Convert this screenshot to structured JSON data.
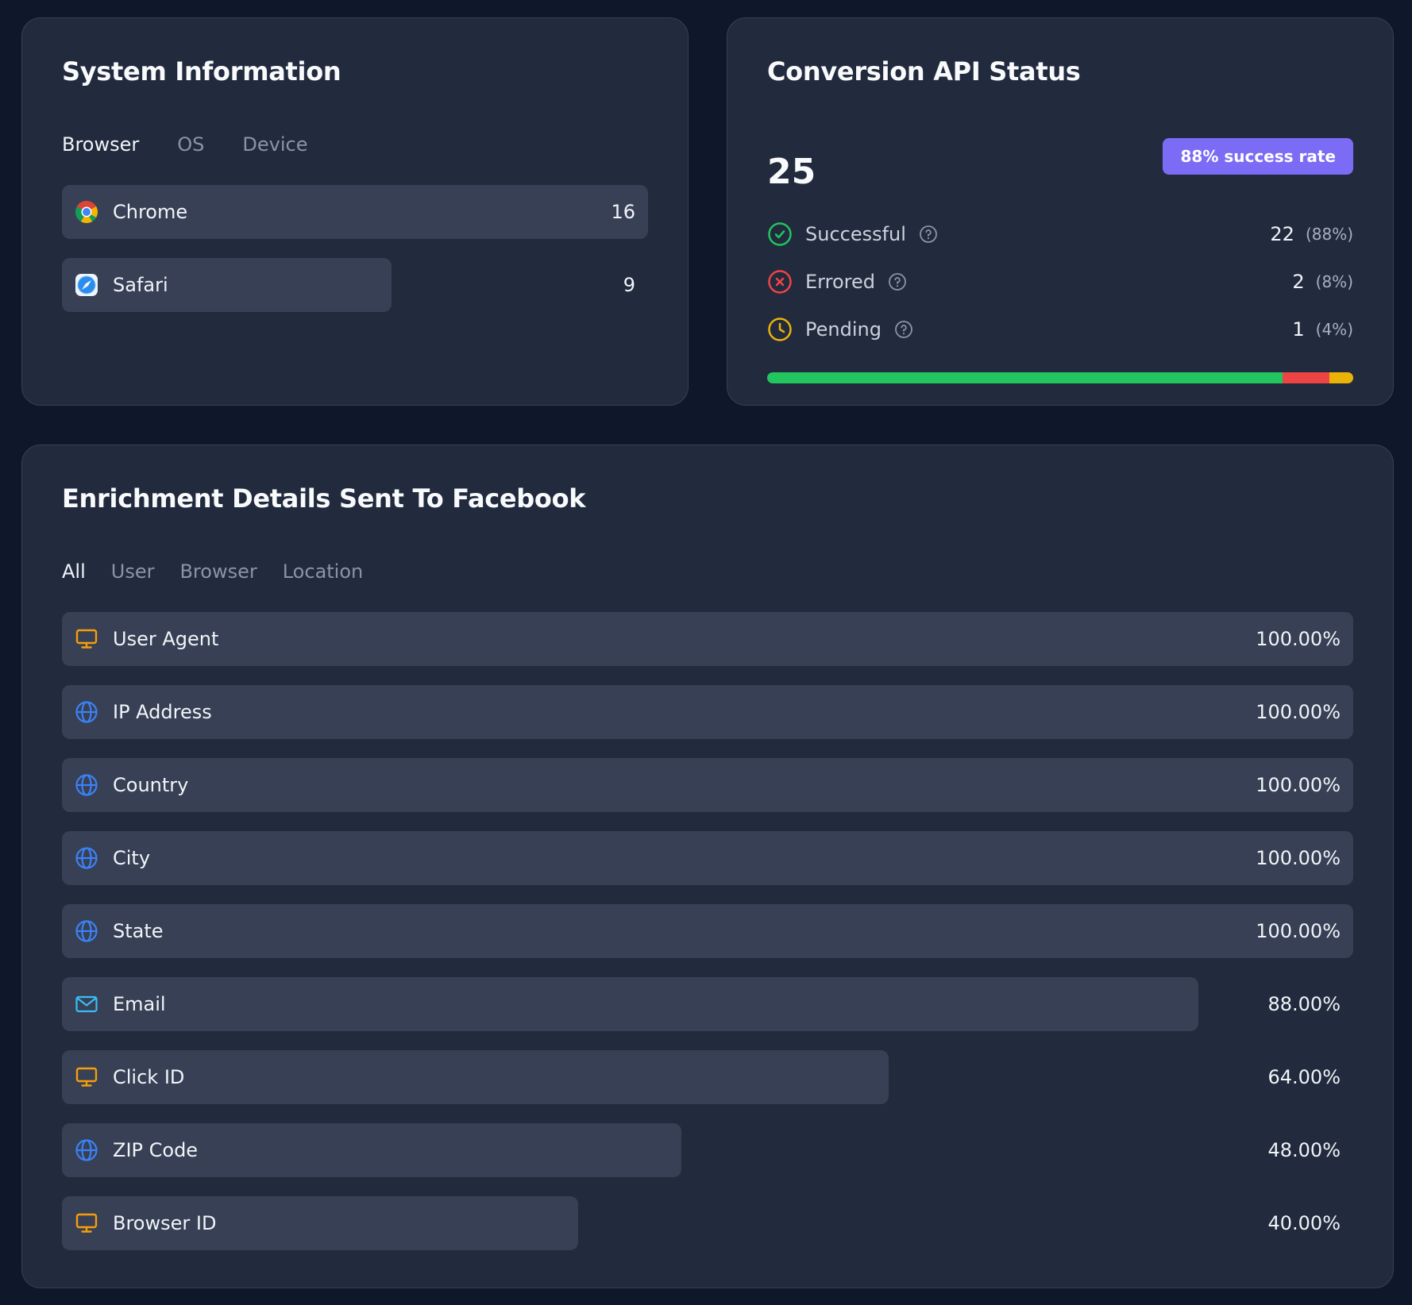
{
  "system_info": {
    "title": "System Information",
    "tabs": [
      {
        "label": "Browser",
        "active": true
      },
      {
        "label": "OS",
        "active": false
      },
      {
        "label": "Device",
        "active": false
      }
    ],
    "rows": [
      {
        "label": "Chrome",
        "value": "16",
        "count": 16,
        "icon": "chrome-icon"
      },
      {
        "label": "Safari",
        "value": "9",
        "count": 9,
        "icon": "safari-icon"
      }
    ]
  },
  "conversion_api": {
    "title": "Conversion API Status",
    "total": "25",
    "success_badge": "88% success rate",
    "statuses": [
      {
        "label": "Successful",
        "count": "22",
        "percent": "(88%)",
        "color": "#22c55e",
        "icon": "check-circle-icon",
        "fraction": 0.88
      },
      {
        "label": "Errored",
        "count": "2",
        "percent": "(8%)",
        "color": "#ef4444",
        "icon": "x-circle-icon",
        "fraction": 0.08
      },
      {
        "label": "Pending",
        "count": "1",
        "percent": "(4%)",
        "color": "#eab308",
        "icon": "clock-icon",
        "fraction": 0.04
      }
    ]
  },
  "enrichment": {
    "title": "Enrichment Details Sent To Facebook",
    "tabs": [
      {
        "label": "All",
        "active": true
      },
      {
        "label": "User",
        "active": false
      },
      {
        "label": "Browser",
        "active": false
      },
      {
        "label": "Location",
        "active": false
      }
    ],
    "rows": [
      {
        "label": "User Agent",
        "value": "100.00%",
        "fraction": 1.0,
        "icon": "monitor-icon"
      },
      {
        "label": "IP Address",
        "value": "100.00%",
        "fraction": 1.0,
        "icon": "globe-icon"
      },
      {
        "label": "Country",
        "value": "100.00%",
        "fraction": 1.0,
        "icon": "globe-icon"
      },
      {
        "label": "City",
        "value": "100.00%",
        "fraction": 1.0,
        "icon": "globe-icon"
      },
      {
        "label": "State",
        "value": "100.00%",
        "fraction": 1.0,
        "icon": "globe-icon"
      },
      {
        "label": "Email",
        "value": "88.00%",
        "fraction": 0.88,
        "icon": "mail-icon"
      },
      {
        "label": "Click ID",
        "value": "64.00%",
        "fraction": 0.64,
        "icon": "monitor-icon"
      },
      {
        "label": "ZIP Code",
        "value": "48.00%",
        "fraction": 0.48,
        "icon": "globe-icon"
      },
      {
        "label": "Browser ID",
        "value": "40.00%",
        "fraction": 0.4,
        "icon": "monitor-icon"
      }
    ]
  },
  "colors": {
    "background": "#0f172a",
    "card": "#222a3e",
    "bar": "#384055",
    "accent": "#7c6cf5",
    "monitor_icon": "#f59e0b",
    "globe_icon": "#3b82f6",
    "mail_icon": "#38bdf8"
  }
}
